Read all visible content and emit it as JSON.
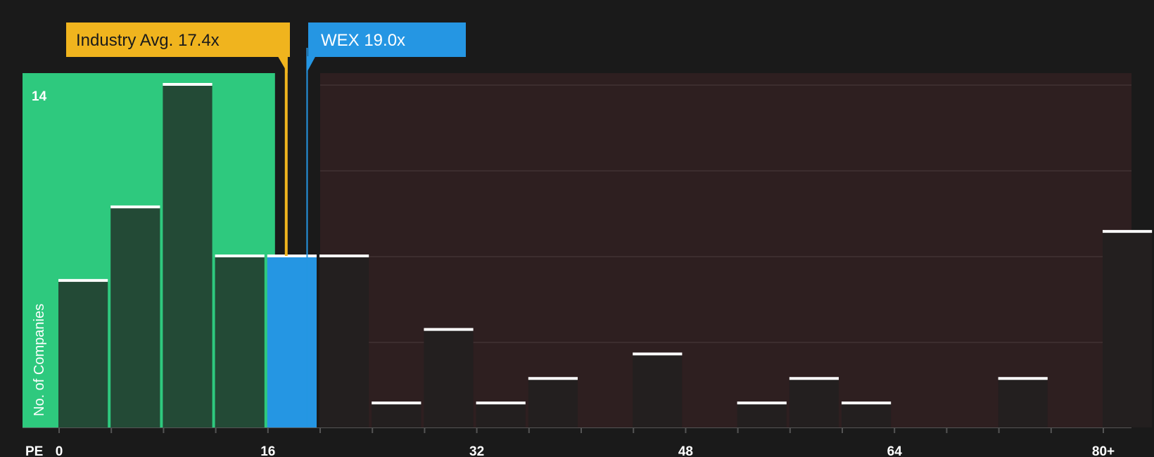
{
  "chart_data": {
    "type": "bar",
    "subject": {
      "label": "WEX 19.0x",
      "value": 19.0
    },
    "industry_average": {
      "label": "Industry Avg. 17.4x",
      "value": 17.4
    },
    "x_axis_label": "PE",
    "y_axis_label": "No. of Companies",
    "y_max_label": "14",
    "ylim": [
      0,
      14
    ],
    "x_tick_labels": [
      "0",
      "16",
      "32",
      "48",
      "64",
      "80+"
    ],
    "bin_width": 4,
    "bins": [
      {
        "start": 0,
        "end": 4,
        "count": 6
      },
      {
        "start": 4,
        "end": 8,
        "count": 9
      },
      {
        "start": 8,
        "end": 12,
        "count": 14
      },
      {
        "start": 12,
        "end": 16,
        "count": 7
      },
      {
        "start": 16,
        "end": 20,
        "count": 7
      },
      {
        "start": 20,
        "end": 24,
        "count": 7
      },
      {
        "start": 24,
        "end": 28,
        "count": 1
      },
      {
        "start": 28,
        "end": 32,
        "count": 4
      },
      {
        "start": 32,
        "end": 36,
        "count": 1
      },
      {
        "start": 36,
        "end": 40,
        "count": 2
      },
      {
        "start": 40,
        "end": 44,
        "count": 0
      },
      {
        "start": 44,
        "end": 48,
        "count": 3
      },
      {
        "start": 48,
        "end": 52,
        "count": 0
      },
      {
        "start": 52,
        "end": 56,
        "count": 1
      },
      {
        "start": 56,
        "end": 60,
        "count": 2
      },
      {
        "start": 60,
        "end": 64,
        "count": 1
      },
      {
        "start": 64,
        "end": 68,
        "count": 0
      },
      {
        "start": 68,
        "end": 72,
        "count": 0
      },
      {
        "start": 72,
        "end": 76,
        "count": 2
      },
      {
        "start": 76,
        "end": 80,
        "count": 0
      },
      {
        "start": 80,
        "end": 84,
        "count": 8
      }
    ],
    "colors": {
      "background": "#1a1a1a",
      "fair_zone": "#2ec97e",
      "fair_bar": "#234a36",
      "high_zone": "#2e1f20",
      "high_bar": "#231f1f",
      "subject": "#2596e3",
      "industry": "#f0b41e",
      "bar_top": "#ffffff",
      "text": "#ffffff"
    }
  }
}
